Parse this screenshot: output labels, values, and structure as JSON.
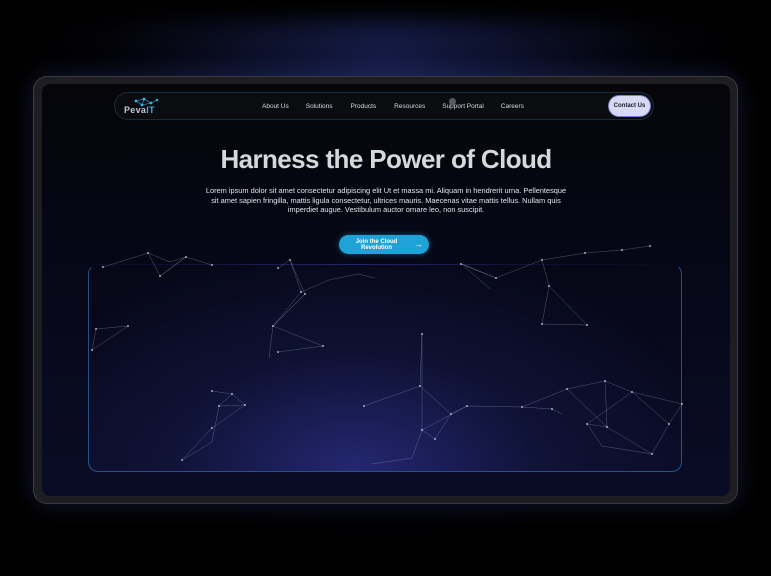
{
  "brand": {
    "logo_part1": "Peva",
    "logo_part2": "IT"
  },
  "nav": {
    "items": [
      {
        "label": "About Us"
      },
      {
        "label": "Solutions"
      },
      {
        "label": "Products"
      },
      {
        "label": "Resources"
      },
      {
        "label": "Support Portal"
      },
      {
        "label": "Careers"
      }
    ],
    "contact_label": "Contact Us"
  },
  "hero": {
    "title": "Harness the Power of Cloud",
    "body": "Lorem ipsum dolor sit amet consectetur adipiscing elit Ut et massa mi. Aliquam in hendrerit urna. Pellentesque sit amet sapien fringilla, mattis ligula consectetur, ultrices mauris. Maecenas vitae mattis tellus. Nullam quis imperdiet augue. Vestibulum auctor ornare leo, non suscipit.",
    "cta_label": "Join the Cloud Revolution",
    "cta_icon": "arrow-right-icon"
  },
  "colors": {
    "accent": "#1fa3d6",
    "contact_button": "#d7d9f5",
    "background": "#05050a"
  }
}
